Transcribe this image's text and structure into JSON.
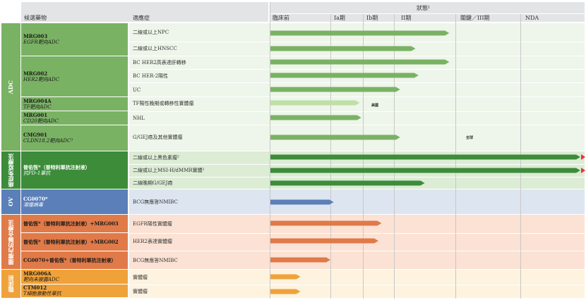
{
  "header": {
    "col_candidate": "候選藥物",
    "col_indication": "適應症",
    "col_status": "狀態¹",
    "stages": [
      "臨床前",
      "Ia期",
      "Ib期",
      "II期",
      "關鍵／III期",
      "NDA"
    ]
  },
  "groups": [
    {
      "label": "ADC",
      "color": "#7ab264"
    },
    {
      "label": "癌症免疫療法",
      "color": "#3c8c3a"
    },
    {
      "label": "OV",
      "color": "#5b7fb9"
    },
    {
      "label": "腫瘤內的聯合療法",
      "color": "#e07a48"
    },
    {
      "label": "臨床前",
      "color": "#f0a23a"
    }
  ],
  "candidates": [
    {
      "code": "MRG003",
      "desc": "EGFR靶向ADC"
    },
    {
      "code": "MRG002",
      "desc": "HER2靶向ADC"
    },
    {
      "code": "MRG004A",
      "desc": "TF靶向ADC"
    },
    {
      "code": "MRG001",
      "desc": "CD20靶向ADC"
    },
    {
      "code": "CMG901",
      "desc": "CLDN18.2靶向ADC³"
    },
    {
      "code": "普佑恆*（普特利單抗注射液）",
      "desc": "抗PD-1單抗"
    },
    {
      "code": "CG0070*",
      "desc": "溶瘤病毒"
    },
    {
      "code": "普佑恆*（普特利單抗注射液）+MRG003",
      "desc": ""
    },
    {
      "code": "普佑恆*（普特利單抗注射液）+MRG002",
      "desc": ""
    },
    {
      "code": "CG0070+普佑恆*（普特利單抗注射液）",
      "desc": ""
    },
    {
      "code": "MRG006A",
      "desc": "靶向未披露ADC"
    },
    {
      "code": "CTM012",
      "desc": "T細胞激動性單抗"
    }
  ],
  "annotations": {
    "us": "美國",
    "global": "全球"
  },
  "chart_data": {
    "type": "bar",
    "orientation": "horizontal",
    "x_axis": "stage",
    "stages": [
      "臨床前",
      "Ia期",
      "Ib期",
      "II期",
      "關鍵／III期",
      "NDA"
    ],
    "rows": [
      {
        "indication": "二線或以上NPC",
        "progress": 3.9
      },
      {
        "indication": "二線或以上HNSCC",
        "progress": 3.35
      },
      {
        "indication": "BC HER2高表達肝轉移",
        "progress": 3.9
      },
      {
        "indication": "BC HER-2陽性",
        "progress": 3.4
      },
      {
        "indication": "UC",
        "progress": 3.1
      },
      {
        "indication": "TF陽性晚期或轉移性實體瘤",
        "progress": 1.9,
        "note": "美國"
      },
      {
        "indication": "NHL",
        "progress": 1.95
      },
      {
        "indication": "G/GEJ癌及其他實體瘤",
        "progress": 3.1,
        "note": "全球"
      },
      {
        "indication": "二線或以上黑色素瘤²",
        "progress": 6.0
      },
      {
        "indication": "二線或以上MSI-H/dMMR實體²",
        "progress": 6.0
      },
      {
        "indication": "二線晚期G/GEJ癌",
        "progress": 3.5
      },
      {
        "indication": "BCG無應答NMIBC",
        "progress": 1.1
      },
      {
        "indication": "EGFR陽性實體瘤",
        "progress": 2.6
      },
      {
        "indication": "HER2表達實體瘤",
        "progress": 2.5
      },
      {
        "indication": "BCG無應答NMIBC",
        "progress": 1.0
      },
      {
        "indication": "實體瘤",
        "progress": 0.5
      },
      {
        "indication": "實體瘤",
        "progress": 0.5
      }
    ]
  }
}
